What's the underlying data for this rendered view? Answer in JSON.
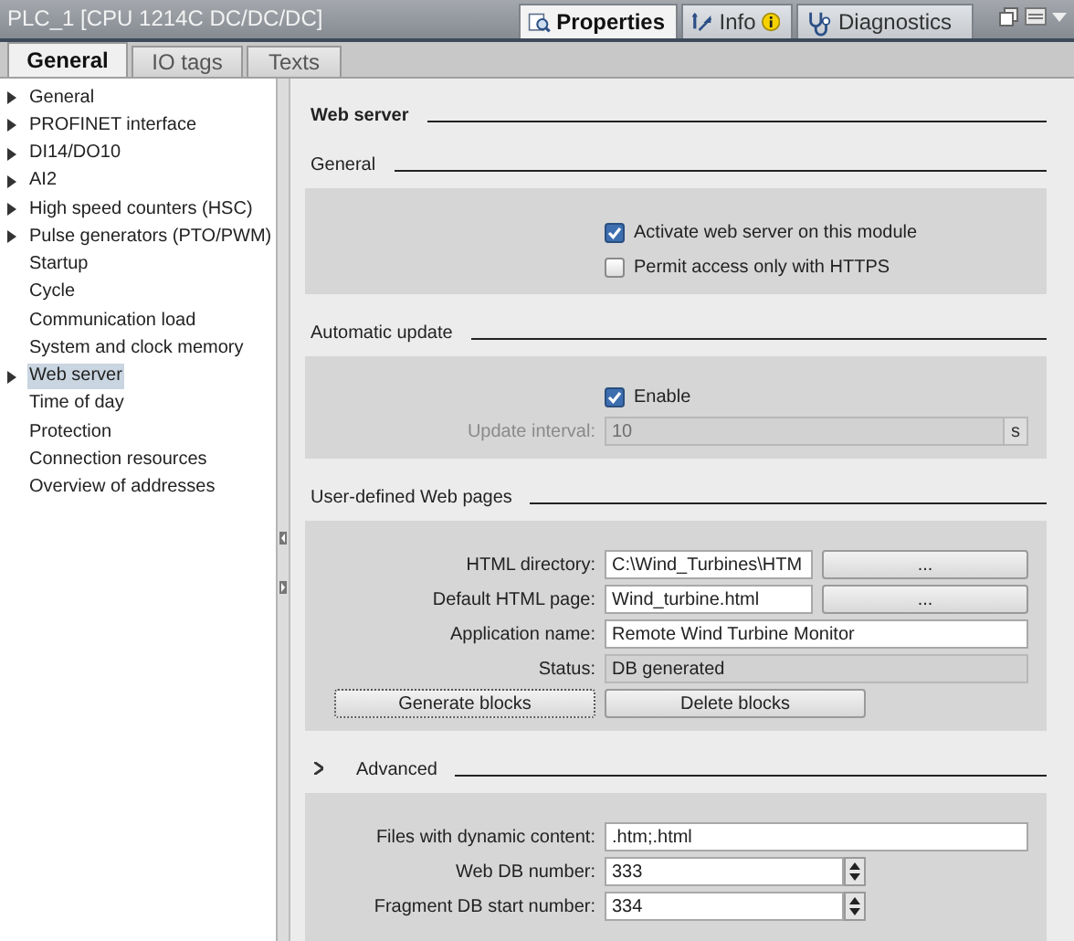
{
  "window": {
    "title": "PLC_1 [CPU 1214C DC/DC/DC]"
  },
  "inspector_tabs": [
    {
      "label": "Properties",
      "kind": "properties",
      "selected": true
    },
    {
      "label": "Info",
      "kind": "info",
      "selected": false
    },
    {
      "label": "Diagnostics",
      "kind": "diagnostics",
      "selected": false
    }
  ],
  "tabs": [
    {
      "label": "General",
      "selected": true
    },
    {
      "label": "IO tags",
      "selected": false
    },
    {
      "label": "Texts",
      "selected": false
    }
  ],
  "sidebar": {
    "items": [
      {
        "label": "General",
        "expandable": true,
        "selected": false
      },
      {
        "label": "PROFINET interface",
        "expandable": true,
        "selected": false
      },
      {
        "label": "DI14/DO10",
        "expandable": true,
        "selected": false
      },
      {
        "label": "AI2",
        "expandable": true,
        "selected": false
      },
      {
        "label": "High speed counters (HSC)",
        "expandable": true,
        "selected": false
      },
      {
        "label": "Pulse generators (PTO/PWM)",
        "expandable": true,
        "selected": false
      },
      {
        "label": "Startup",
        "expandable": false,
        "selected": false
      },
      {
        "label": "Cycle",
        "expandable": false,
        "selected": false
      },
      {
        "label": "Communication load",
        "expandable": false,
        "selected": false
      },
      {
        "label": "System and clock memory",
        "expandable": false,
        "selected": false
      },
      {
        "label": "Web server",
        "expandable": true,
        "selected": true
      },
      {
        "label": "Time of day",
        "expandable": false,
        "selected": false
      },
      {
        "label": "Protection",
        "expandable": false,
        "selected": false
      },
      {
        "label": "Connection resources",
        "expandable": false,
        "selected": false
      },
      {
        "label": "Overview of addresses",
        "expandable": false,
        "selected": false
      }
    ]
  },
  "content": {
    "title": "Web server",
    "sections": [
      {
        "title": "General",
        "collapsible": false,
        "rows": [
          {
            "kind": "checkbox",
            "label": "Activate web server on this module",
            "checked": true
          },
          {
            "kind": "checkbox",
            "label": "Permit access only with HTTPS",
            "checked": false
          }
        ]
      },
      {
        "title": "Automatic update",
        "collapsible": false,
        "rows": [
          {
            "kind": "checkbox",
            "label": "Enable",
            "checked": true
          },
          {
            "kind": "field",
            "label": "Update interval:",
            "value": "10",
            "unit": "s",
            "disabled": true
          }
        ]
      },
      {
        "title": "User-defined Web pages",
        "collapsible": false,
        "rows": [
          {
            "kind": "browse",
            "label": "HTML directory:",
            "value": "C:\\Wind_Turbines\\HTM",
            "button": "..."
          },
          {
            "kind": "browse",
            "label": "Default HTML page:",
            "value": "Wind_turbine.html",
            "button": "..."
          },
          {
            "kind": "field",
            "label": "Application name:",
            "value": "Remote Wind Turbine Monitor",
            "disabled": false
          },
          {
            "kind": "field",
            "label": "Status:",
            "value": "DB generated",
            "readonly": true,
            "disabled": false
          },
          {
            "kind": "buttons",
            "buttons": [
              "Generate blocks",
              "Delete blocks"
            ]
          }
        ]
      },
      {
        "title": "Advanced",
        "collapsible": true,
        "rows": [
          {
            "kind": "field",
            "label": "Files with dynamic content:",
            "value": ".htm;.html",
            "disabled": false
          },
          {
            "kind": "spinner",
            "label": "Web DB number:",
            "value": "333"
          },
          {
            "kind": "spinner",
            "label": "Fragment DB start number:",
            "value": "334"
          }
        ]
      }
    ]
  }
}
